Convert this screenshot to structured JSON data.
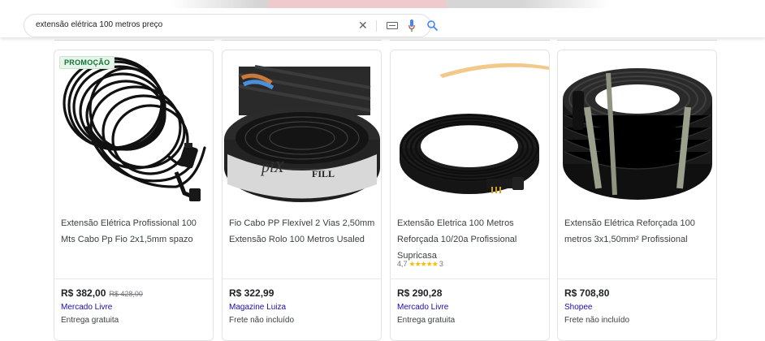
{
  "search": {
    "query": "extensão elétrica 100 metros preço"
  },
  "icons": {
    "clear": "close-icon",
    "keyboard": "keyboard-icon",
    "mic": "microphone-icon",
    "search": "search-icon"
  },
  "colors": {
    "link": "#1a0dab",
    "badge_bg": "#e6f4ea",
    "badge_text": "#137333",
    "stars": "#fbbc04",
    "mic_red": "#ea4335",
    "mic_blue": "#4285f4"
  },
  "products": [
    {
      "badge": "PROMOÇÃO",
      "title": "Extensão Elétrica Profissional 100 Mts Cabo Pp Fio 2x1,5mm spazo",
      "price": "R$ 382,00",
      "old_price": "R$ 428,00",
      "store": "Mercado Livre",
      "shipping": "Entrega gratuita"
    },
    {
      "title": "Fio Cabo PP Flexível 2 Vias 2,50mm Extensão Rolo 100 Metros Usaled",
      "price": "R$ 322,99",
      "store": "Magazine Luiza",
      "shipping": "Frete não incluído",
      "image_text": [
        "piX",
        "FILL"
      ]
    },
    {
      "title": "Extensão Eletrica 100 Metros Reforçada 10/20a Profissional Supricasa",
      "rating": "4,7",
      "stars": "★★★★★",
      "reviews": "3",
      "price": "R$ 290,28",
      "store": "Mercado Livre",
      "shipping": "Entrega gratuita"
    },
    {
      "title": "Extensão Elétrica Reforçada 100 metros 3x1,50mm² Profissional",
      "price": "R$ 708,80",
      "store": "Shopee",
      "shipping": "Frete não incluído"
    }
  ]
}
